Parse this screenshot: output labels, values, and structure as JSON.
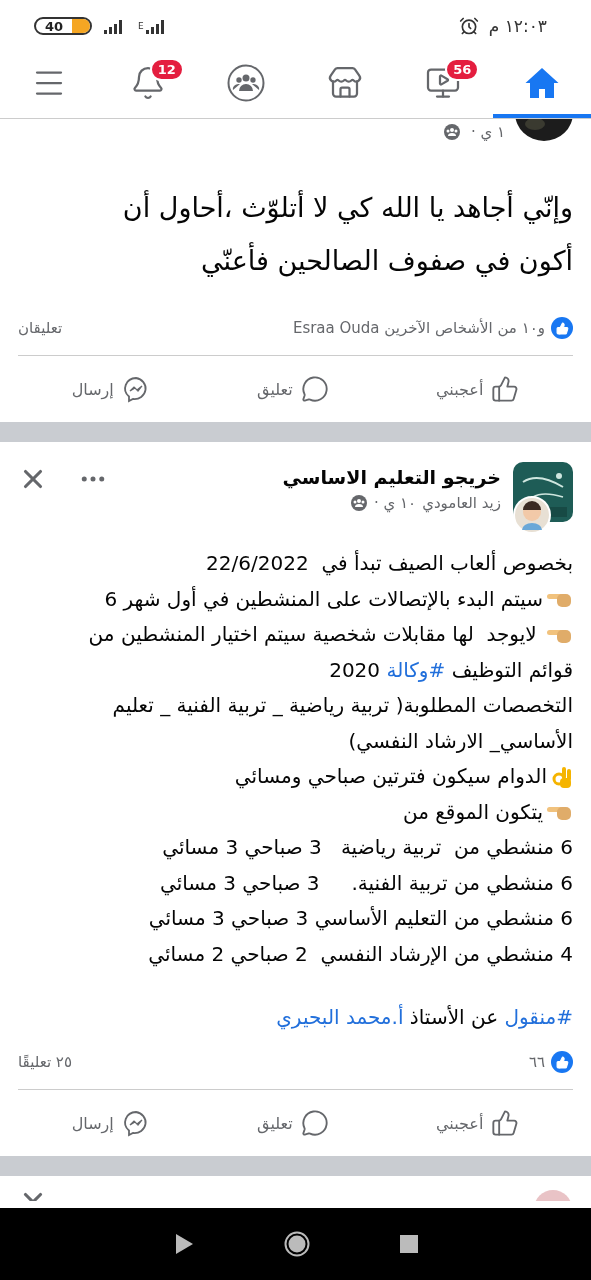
{
  "status_bar": {
    "time": "١٢:٠٣ م",
    "battery": "40",
    "network": "E"
  },
  "nav_tabs": [
    {
      "kind": "home",
      "selected": true
    },
    {
      "kind": "watch",
      "badge": "56",
      "selected": false
    },
    {
      "kind": "marketplace",
      "selected": false
    },
    {
      "kind": "groups",
      "selected": false
    },
    {
      "kind": "notifications",
      "badge": "12",
      "selected": false
    },
    {
      "kind": "menu",
      "selected": false
    }
  ],
  "posts": [
    {
      "kind": "partial",
      "time": "١ ي ·",
      "text_lines": [
        {
          "kind": "plain",
          "segments": [
            {
              "text": "وإنّي أجاهد يا الله كي لا أتلوّث ،أحاول أن"
            }
          ]
        },
        {
          "kind": "plain",
          "segments": [
            {
              "text": "أكون في صفوف الصالحين فأعنّي"
            }
          ]
        }
      ],
      "reactions": "و١٠ من الأشخاص الآخرين Esraa Ouda",
      "comments": "تعليقان",
      "actions": [
        {
          "kind": "like",
          "label": "أعجبني"
        },
        {
          "kind": "comment",
          "label": "تعليق"
        },
        {
          "kind": "send",
          "label": "إرسال"
        }
      ]
    },
    {
      "kind": "full",
      "page": "خريجو التعليم الاساسي",
      "author": "زيد العامودي",
      "time": "١٠ ي ·",
      "text_lines": [
        {
          "kind": "plain",
          "segments": [
            {
              "text": "بخصوص ألعاب الصيف تبدأ في  22/6/2022"
            }
          ]
        },
        {
          "kind": "pointing_bullet",
          "segments": [
            {
              "text": "سيتم البدء بالإتصالات على المنشطين في أول شهر 6"
            }
          ]
        },
        {
          "kind": "pointing_bullet",
          "segments": [
            {
              "text": " لايوجد  لها مقابلات شخصية سيتم اختيار المنشطين من"
            }
          ]
        },
        {
          "kind": "plain",
          "segments": [
            {
              "text": "قوائم التوظيف "
            },
            {
              "text": "#وكالة",
              "link": true
            },
            {
              "text": " 2020"
            }
          ]
        },
        {
          "kind": "plain",
          "segments": [
            {
              "text": "التخصصات المطلوبة( تربية رياضية _ تربية الفنية _ تعليم"
            }
          ]
        },
        {
          "kind": "plain",
          "segments": [
            {
              "text": "الأساسي_ الارشاد النفسي)"
            }
          ]
        },
        {
          "kind": "ok_bullet",
          "segments": [
            {
              "text": "الدوام سيكون فترتين صباحي ومسائي"
            }
          ]
        },
        {
          "kind": "pointing_bullet",
          "segments": [
            {
              "text": "يتكون الموقع من"
            }
          ]
        },
        {
          "kind": "plain",
          "segments": [
            {
              "text": "6 منشطي من  تربية رياضية   3 صباحي 3 مسائي"
            }
          ]
        },
        {
          "kind": "plain",
          "segments": [
            {
              "text": "6 منشطي من تربية الفنية.     3 صباحي 3 مسائي"
            }
          ]
        },
        {
          "kind": "plain",
          "segments": [
            {
              "text": "6 منشطي من التعليم الأساسي 3 صباحي 3 مسائي"
            }
          ]
        },
        {
          "kind": "plain",
          "segments": [
            {
              "text": "4 منشطي من الإرشاد النفسي  2 صباحي 2 مسائي"
            }
          ]
        }
      ],
      "source": [
        {
          "text": "#منقول",
          "link": true
        },
        {
          "text": " عن الأستاذ "
        },
        {
          "text": "أ.محمد البحيري",
          "link": true
        }
      ],
      "reactions": "٦٦",
      "comments": "٢٥ تعليقًا",
      "actions": [
        {
          "kind": "like",
          "label": "أعجبني"
        },
        {
          "kind": "comment",
          "label": "تعليق"
        },
        {
          "kind": "send",
          "label": "إرسال"
        }
      ]
    },
    {
      "kind": "cut"
    }
  ]
}
